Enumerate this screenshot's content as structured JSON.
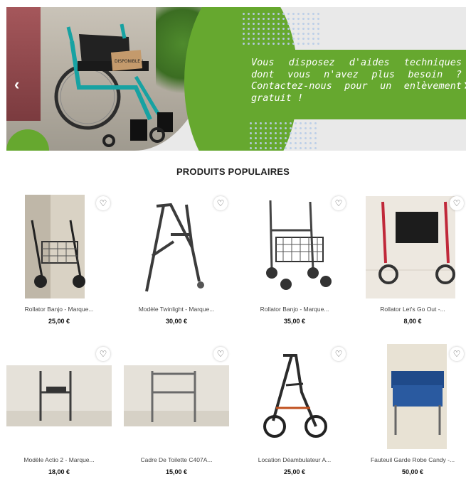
{
  "banner": {
    "message": "Vous disposez d'aides techniques dont vous n'avez plus besoin ? Contactez-nous pour un enlèvement gratuit !",
    "sign_text": "DISPONIBLE !",
    "prev_icon": "chevron-left-icon",
    "next_icon": "chevron-right-icon",
    "accent_color": "#66a82f"
  },
  "section": {
    "title": "PRODUITS POPULAIRES"
  },
  "products": [
    {
      "name": "Rollator Banjo - Marque...",
      "price": "25,00 €"
    },
    {
      "name": "Modèle Twinlight - Marque...",
      "price": "30,00 €"
    },
    {
      "name": "Rollator Banjo - Marque...",
      "price": "35,00 €"
    },
    {
      "name": "Rollator Let's Go Out -...",
      "price": "8,00 €"
    },
    {
      "name": "Modèle Actio 2 - Marque...",
      "price": "18,00 €"
    },
    {
      "name": "Cadre De Toilette C407A...",
      "price": "15,00 €"
    },
    {
      "name": "Location Déambulateur A...",
      "price": "25,00 €"
    },
    {
      "name": "Fauteuil Garde Robe Candy -...",
      "price": "50,00 €"
    }
  ],
  "icons": {
    "wishlist": "heart-icon"
  }
}
